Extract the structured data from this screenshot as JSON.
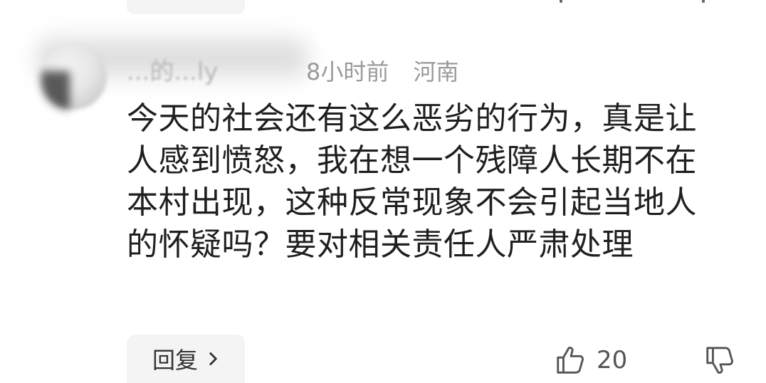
{
  "comment": {
    "username": "...的...ly",
    "time": "8小时前",
    "location": "河南",
    "text": "今天的社会还有这么恶劣的行为，真是让人感到愤怒，我在想一个残障人长期不在本村出现，这种反常现象不会引起当地人的怀疑吗？要对相关责任人严肃处理",
    "reply_label": "回复",
    "like_count": "20"
  },
  "icons": {
    "avatar": "user-avatar",
    "reply_chevron": "chevron-right-icon",
    "like": "thumbs-up-icon",
    "dislike": "thumbs-down-icon"
  }
}
